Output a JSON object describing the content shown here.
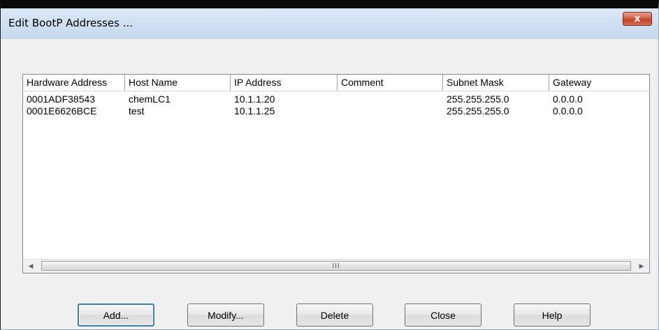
{
  "window": {
    "title": "Edit BootP Addresses ...",
    "close_glyph": "x"
  },
  "table": {
    "columns": [
      "Hardware Address",
      "Host Name",
      "IP Address",
      "Comment",
      "Subnet Mask",
      "Gateway"
    ],
    "rows": [
      [
        "0001ADF38543",
        "chemLC1",
        "10.1.1.20",
        "",
        "255.255.255.0",
        "0.0.0.0"
      ],
      [
        "0001E6626BCE",
        "test",
        "10.1.1.25",
        "",
        "255.255.255.0",
        "0.0.0.0"
      ]
    ]
  },
  "scrollbar": {
    "left_arrow": "◀",
    "right_arrow": "▶",
    "grip": "III"
  },
  "buttons": {
    "add": "Add...",
    "modify": "Modify...",
    "delete": "Delete",
    "close": "Close",
    "help": "Help"
  }
}
